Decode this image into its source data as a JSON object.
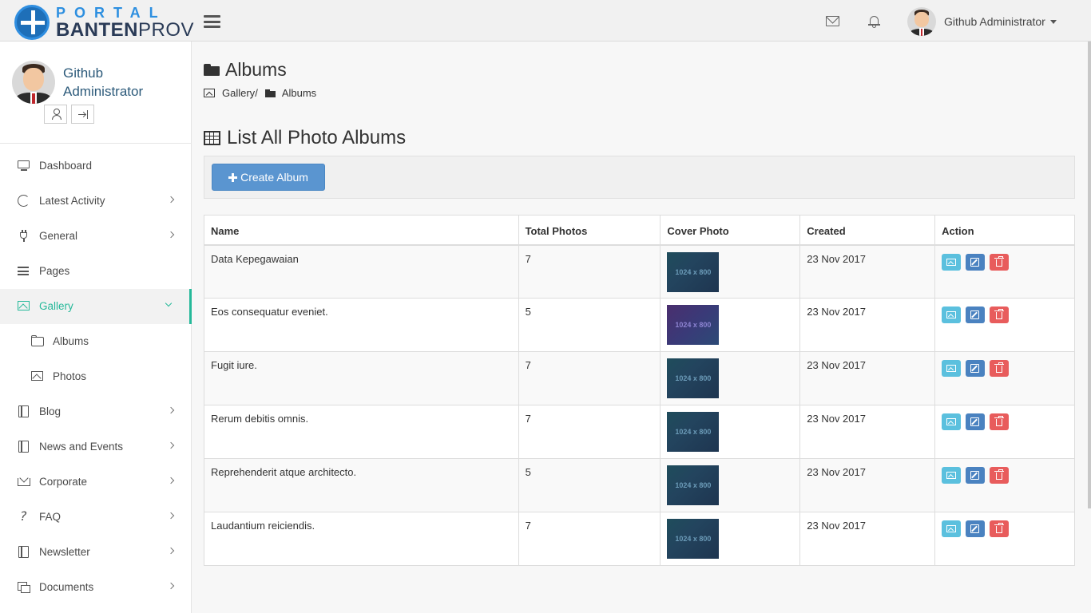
{
  "header": {
    "logo_top": "PORTAL",
    "logo_bottom_bold": "BANTEN",
    "logo_bottom_light": "PROV",
    "user_name": "Github Administrator"
  },
  "sidebar": {
    "profile_name": "Github Administrator",
    "items": [
      {
        "label": "Dashboard",
        "icon": "monitor-icon",
        "has_arrow": false
      },
      {
        "label": "Latest Activity",
        "icon": "refresh-icon",
        "has_arrow": true
      },
      {
        "label": "General",
        "icon": "plug-icon",
        "has_arrow": true
      },
      {
        "label": "Pages",
        "icon": "list-icon",
        "has_arrow": false
      },
      {
        "label": "Gallery",
        "icon": "picture-icon",
        "has_arrow": true,
        "active": true
      },
      {
        "label": "Albums",
        "icon": "folder-icon",
        "sub": true
      },
      {
        "label": "Photos",
        "icon": "picture-icon",
        "sub": true
      },
      {
        "label": "Blog",
        "icon": "book-icon",
        "has_arrow": true
      },
      {
        "label": "News and Events",
        "icon": "book-icon",
        "has_arrow": true
      },
      {
        "label": "Corporate",
        "icon": "crown-icon",
        "has_arrow": true
      },
      {
        "label": "FAQ",
        "icon": "question-icon",
        "has_arrow": true
      },
      {
        "label": "Newsletter",
        "icon": "book-icon",
        "has_arrow": true
      },
      {
        "label": "Documents",
        "icon": "documents-icon",
        "has_arrow": true
      }
    ]
  },
  "page": {
    "title": "Albums",
    "breadcrumb": {
      "parent": "Gallery",
      "separator": "/",
      "current": "Albums"
    },
    "section_title": "List All Photo Albums",
    "create_button": "Create Album"
  },
  "table": {
    "headers": [
      "Name",
      "Total Photos",
      "Cover Photo",
      "Created",
      "Action"
    ],
    "rows": [
      {
        "name": "Data Kepegawaian",
        "total": "7",
        "cover": "1024 x 800",
        "cover_tone": "teal",
        "created": "23 Nov 2017"
      },
      {
        "name": "Eos consequatur eveniet.",
        "total": "5",
        "cover": "1024 x 800",
        "cover_tone": "purple",
        "created": "23 Nov 2017"
      },
      {
        "name": "Fugit iure.",
        "total": "7",
        "cover": "1024 x 800",
        "cover_tone": "teal",
        "created": "23 Nov 2017"
      },
      {
        "name": "Rerum debitis omnis.",
        "total": "7",
        "cover": "1024 x 800",
        "cover_tone": "teal",
        "created": "23 Nov 2017"
      },
      {
        "name": "Reprehenderit atque architecto.",
        "total": "5",
        "cover": "1024 x 800",
        "cover_tone": "teal",
        "created": "23 Nov 2017"
      },
      {
        "name": "Laudantium reiciendis.",
        "total": "7",
        "cover": "1024 x 800",
        "cover_tone": "teal",
        "created": "23 Nov 2017"
      }
    ]
  },
  "colors": {
    "accent": "#26b99a",
    "primary_button": "#5a95d0",
    "view_button": "#5bc0de",
    "edit_button": "#4a82c0",
    "delete_button": "#e85c5c"
  }
}
